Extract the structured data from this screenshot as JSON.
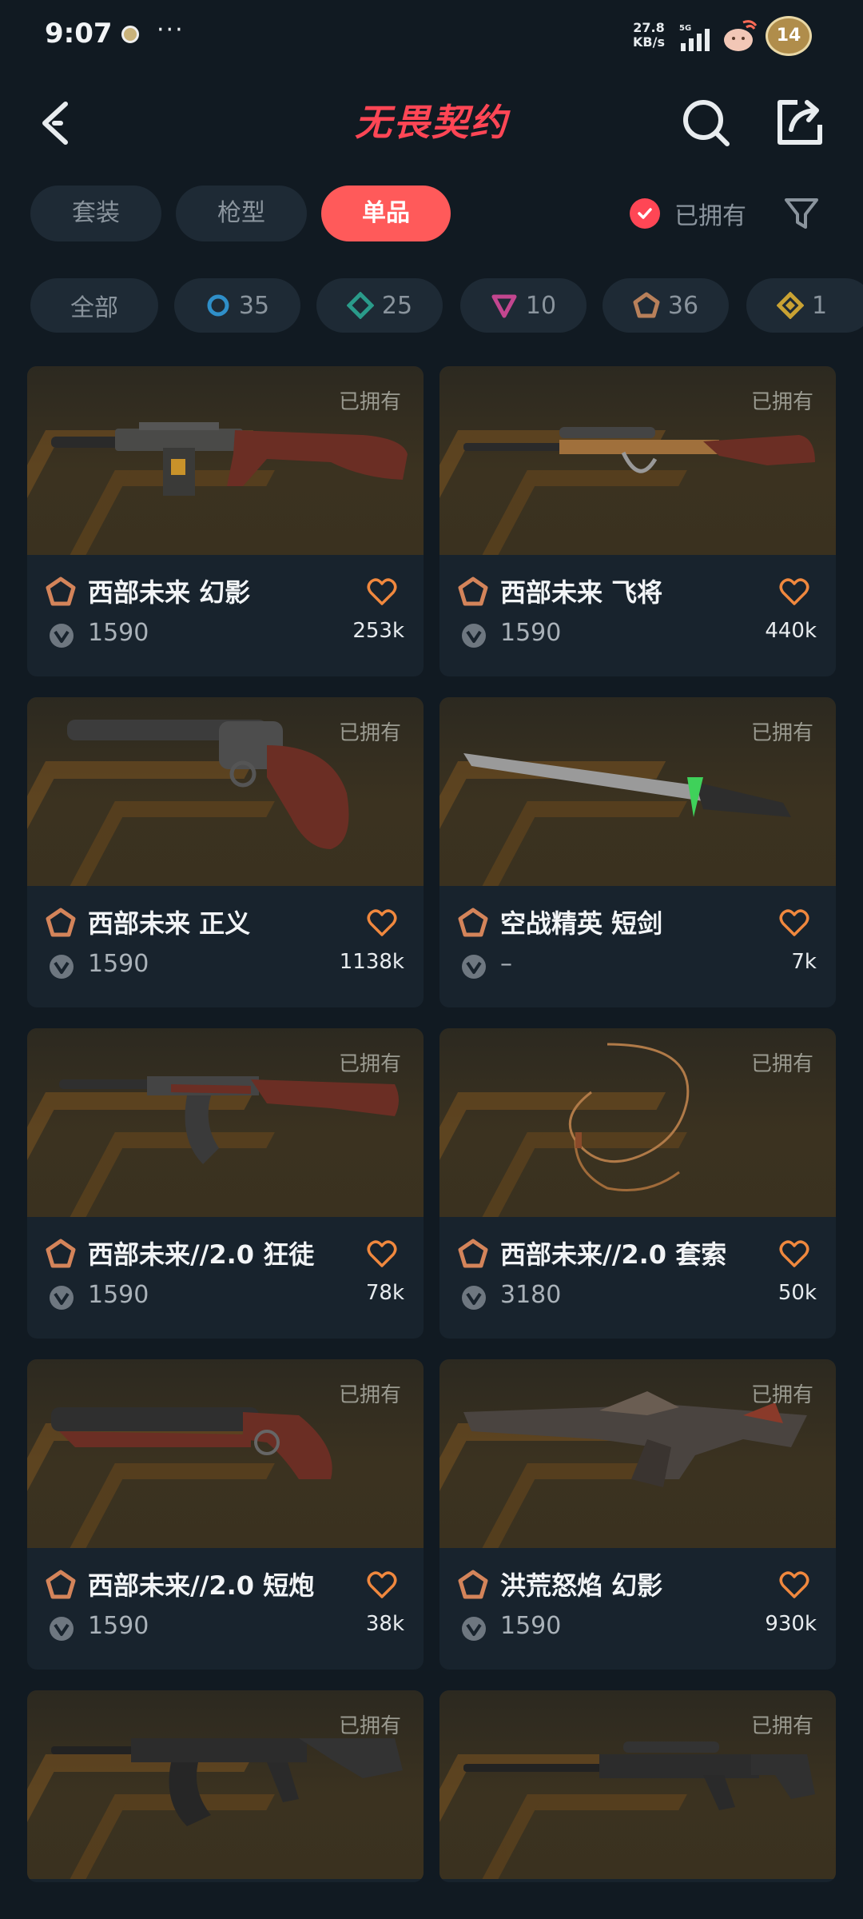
{
  "status_bar": {
    "time": "9:07",
    "more": "···",
    "speed_top": "27.8",
    "speed_bottom": "KB/s",
    "network": "5G",
    "battery": "14"
  },
  "header": {
    "logo": "无畏契约"
  },
  "tabs": [
    {
      "label": "套装",
      "active": false
    },
    {
      "label": "枪型",
      "active": false
    },
    {
      "label": "单品",
      "active": true
    }
  ],
  "owned_filter_label": "已拥有",
  "chips": [
    {
      "label": "全部"
    },
    {
      "label": "35",
      "icon": "circle-tier-icon",
      "color": "#2f8fc9"
    },
    {
      "label": "25",
      "icon": "diamond-tier-icon",
      "color": "#2a9b8a"
    },
    {
      "label": "10",
      "icon": "triangle-tier-icon",
      "color": "#c3468f"
    },
    {
      "label": "36",
      "icon": "pentagon-tier-icon",
      "color": "#b8805a"
    },
    {
      "label": "1",
      "icon": "rhombus-tier-icon",
      "color": "#c9a233"
    }
  ],
  "items": [
    {
      "owned": "已拥有",
      "name": "西部未来 幻影",
      "price": "1590",
      "likes": "253k",
      "weapon": "rifle"
    },
    {
      "owned": "已拥有",
      "name": "西部未来 飞将",
      "price": "1590",
      "likes": "440k",
      "weapon": "sniper"
    },
    {
      "owned": "已拥有",
      "name": "西部未来 正义",
      "price": "1590",
      "likes": "1138k",
      "weapon": "revolver"
    },
    {
      "owned": "已拥有",
      "name": "空战精英 短剑",
      "price": "–",
      "likes": "7k",
      "weapon": "knife"
    },
    {
      "owned": "已拥有",
      "name": "西部未来//2.0 狂徒",
      "price": "1590",
      "likes": "78k",
      "weapon": "ak"
    },
    {
      "owned": "已拥有",
      "name": "西部未来//2.0 套索",
      "price": "3180",
      "likes": "50k",
      "weapon": "lasso"
    },
    {
      "owned": "已拥有",
      "name": "西部未来//2.0 短炮",
      "price": "1590",
      "likes": "38k",
      "weapon": "shorty"
    },
    {
      "owned": "已拥有",
      "name": "洪荒怒焰 幻影",
      "price": "1590",
      "likes": "930k",
      "weapon": "dragon"
    },
    {
      "owned": "已拥有",
      "name": "",
      "price": "",
      "likes": "",
      "weapon": "ak-black"
    },
    {
      "owned": "已拥有",
      "name": "",
      "price": "",
      "likes": "",
      "weapon": "operator-black"
    }
  ]
}
